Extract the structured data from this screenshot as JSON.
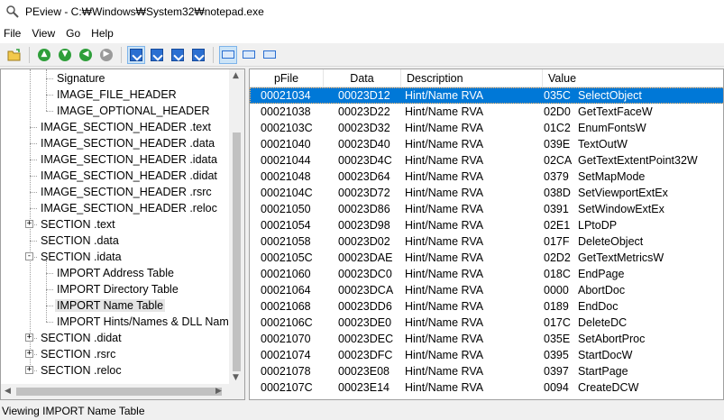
{
  "window": {
    "title": "PEview - C:₩Windows₩System32₩notepad.exe"
  },
  "menu": [
    "File",
    "View",
    "Go",
    "Help"
  ],
  "toolbar": {
    "buttons": [
      "open-icon",
      "arrow-up-icon",
      "arrow-down-icon",
      "back-icon",
      "forward-icon",
      "view-byte-icon",
      "view-word-icon",
      "view-dword-icon",
      "view-qword-icon",
      "list-view-icon",
      "small-view-icon",
      "large-view-icon"
    ]
  },
  "tree": {
    "items": [
      {
        "label": "Signature",
        "level": 2,
        "expander": ""
      },
      {
        "label": "IMAGE_FILE_HEADER",
        "level": 2,
        "expander": ""
      },
      {
        "label": "IMAGE_OPTIONAL_HEADER",
        "level": 2,
        "expander": ""
      },
      {
        "label": "IMAGE_SECTION_HEADER .text",
        "level": 1,
        "expander": ""
      },
      {
        "label": "IMAGE_SECTION_HEADER .data",
        "level": 1,
        "expander": ""
      },
      {
        "label": "IMAGE_SECTION_HEADER .idata",
        "level": 1,
        "expander": ""
      },
      {
        "label": "IMAGE_SECTION_HEADER .didat",
        "level": 1,
        "expander": ""
      },
      {
        "label": "IMAGE_SECTION_HEADER .rsrc",
        "level": 1,
        "expander": ""
      },
      {
        "label": "IMAGE_SECTION_HEADER .reloc",
        "level": 1,
        "expander": ""
      },
      {
        "label": "SECTION .text",
        "level": 1,
        "expander": "+"
      },
      {
        "label": "SECTION .data",
        "level": 1,
        "expander": ""
      },
      {
        "label": "SECTION .idata",
        "level": 1,
        "expander": "-"
      },
      {
        "label": "IMPORT Address Table",
        "level": 2,
        "expander": ""
      },
      {
        "label": "IMPORT Directory Table",
        "level": 2,
        "expander": ""
      },
      {
        "label": "IMPORT Name Table",
        "level": 2,
        "expander": "",
        "selected": true
      },
      {
        "label": "IMPORT Hints/Names & DLL Names",
        "level": 2,
        "expander": ""
      },
      {
        "label": "SECTION .didat",
        "level": 1,
        "expander": "+"
      },
      {
        "label": "SECTION .rsrc",
        "level": 1,
        "expander": "+"
      },
      {
        "label": "SECTION .reloc",
        "level": 1,
        "expander": "+"
      }
    ]
  },
  "list": {
    "columns": [
      "pFile",
      "Data",
      "Description",
      "Value"
    ],
    "rows": [
      {
        "pfile": "00021034",
        "data": "00023D12",
        "desc": "Hint/Name RVA",
        "hint": "035C",
        "name": "SelectObject",
        "selected": true
      },
      {
        "pfile": "00021038",
        "data": "00023D22",
        "desc": "Hint/Name RVA",
        "hint": "02D0",
        "name": "GetTextFaceW"
      },
      {
        "pfile": "0002103C",
        "data": "00023D32",
        "desc": "Hint/Name RVA",
        "hint": "01C2",
        "name": "EnumFontsW"
      },
      {
        "pfile": "00021040",
        "data": "00023D40",
        "desc": "Hint/Name RVA",
        "hint": "039E",
        "name": "TextOutW"
      },
      {
        "pfile": "00021044",
        "data": "00023D4C",
        "desc": "Hint/Name RVA",
        "hint": "02CA",
        "name": "GetTextExtentPoint32W"
      },
      {
        "pfile": "00021048",
        "data": "00023D64",
        "desc": "Hint/Name RVA",
        "hint": "0379",
        "name": "SetMapMode"
      },
      {
        "pfile": "0002104C",
        "data": "00023D72",
        "desc": "Hint/Name RVA",
        "hint": "038D",
        "name": "SetViewportExtEx"
      },
      {
        "pfile": "00021050",
        "data": "00023D86",
        "desc": "Hint/Name RVA",
        "hint": "0391",
        "name": "SetWindowExtEx"
      },
      {
        "pfile": "00021054",
        "data": "00023D98",
        "desc": "Hint/Name RVA",
        "hint": "02E1",
        "name": "LPtoDP"
      },
      {
        "pfile": "00021058",
        "data": "00023D02",
        "desc": "Hint/Name RVA",
        "hint": "017F",
        "name": "DeleteObject"
      },
      {
        "pfile": "0002105C",
        "data": "00023DAE",
        "desc": "Hint/Name RVA",
        "hint": "02D2",
        "name": "GetTextMetricsW"
      },
      {
        "pfile": "00021060",
        "data": "00023DC0",
        "desc": "Hint/Name RVA",
        "hint": "018C",
        "name": "EndPage"
      },
      {
        "pfile": "00021064",
        "data": "00023DCA",
        "desc": "Hint/Name RVA",
        "hint": "0000",
        "name": "AbortDoc"
      },
      {
        "pfile": "00021068",
        "data": "00023DD6",
        "desc": "Hint/Name RVA",
        "hint": "0189",
        "name": "EndDoc"
      },
      {
        "pfile": "0002106C",
        "data": "00023DE0",
        "desc": "Hint/Name RVA",
        "hint": "017C",
        "name": "DeleteDC"
      },
      {
        "pfile": "00021070",
        "data": "00023DEC",
        "desc": "Hint/Name RVA",
        "hint": "035E",
        "name": "SetAbortProc"
      },
      {
        "pfile": "00021074",
        "data": "00023DFC",
        "desc": "Hint/Name RVA",
        "hint": "0395",
        "name": "StartDocW"
      },
      {
        "pfile": "00021078",
        "data": "00023E08",
        "desc": "Hint/Name RVA",
        "hint": "0397",
        "name": "StartPage"
      },
      {
        "pfile": "0002107C",
        "data": "00023E14",
        "desc": "Hint/Name RVA",
        "hint": "0094",
        "name": "CreateDCW"
      }
    ]
  },
  "status": {
    "text": "Viewing IMPORT Name Table"
  }
}
